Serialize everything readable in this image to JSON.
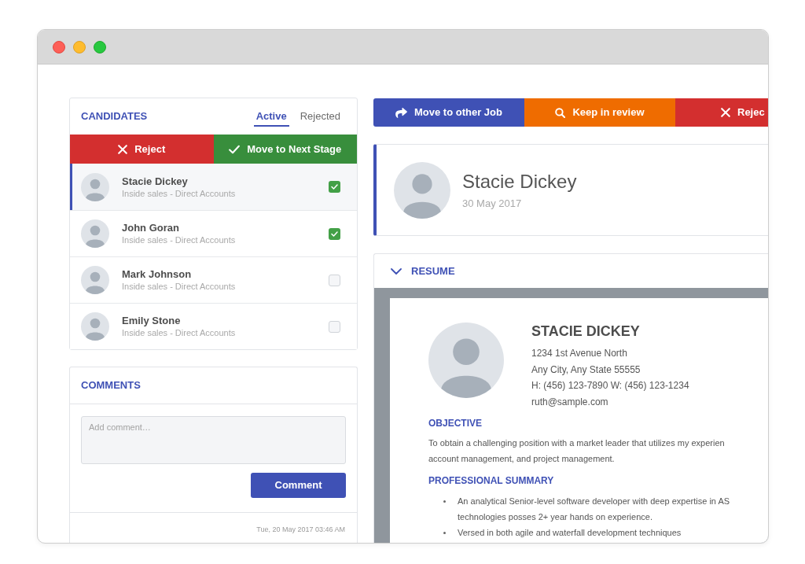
{
  "candidates_panel": {
    "title": "CANDIDATES",
    "tabs": [
      {
        "label": "Active",
        "selected": true
      },
      {
        "label": "Rejected",
        "selected": false
      }
    ],
    "actions": [
      {
        "kind": "reject",
        "label": "Reject"
      },
      {
        "kind": "advance",
        "label": "Move to Next Stage"
      }
    ],
    "candidates": [
      {
        "name": "Stacie Dickey",
        "position": "Inside sales - Direct Accounts",
        "selected": true,
        "checked": true
      },
      {
        "name": "John Goran",
        "position": "Inside sales - Direct Accounts",
        "selected": false,
        "checked": true
      },
      {
        "name": "Mark Johnson",
        "position": "Inside sales - Direct Accounts",
        "selected": false,
        "checked": false
      },
      {
        "name": "Emily Stone",
        "position": "Inside sales - Direct Accounts",
        "selected": false,
        "checked": false
      }
    ]
  },
  "comments_panel": {
    "title": "COMMENTS",
    "comment_field": {
      "placeholder": "Add comment…"
    },
    "button": "Comment",
    "comments": [
      {
        "timestamp": "Tue, 20 May 2017 03:46 AM"
      }
    ]
  },
  "action_bar": [
    {
      "kind": "move",
      "label": "Move to other Job"
    },
    {
      "kind": "review",
      "label": "Keep in review"
    },
    {
      "kind": "reject",
      "label": "Rejec"
    }
  ],
  "candidate_header": {
    "name": "Stacie Dickey",
    "date": "30 May 2017"
  },
  "resume": {
    "title": "RESUME",
    "expanded": true,
    "name": "STACIE DICKEY",
    "contact": [
      "1234 1st Avenue North",
      "Any City, Any State 55555",
      "H: (456) 123-7890 W: (456) 123-1234",
      "ruth@sample.com"
    ],
    "sections": [
      {
        "kind": "paragraph",
        "heading": "OBJECTIVE",
        "lines": [
          "To obtain a challenging position with a market leader that utilizes my experien",
          "account management, and project management."
        ]
      },
      {
        "kind": "bullets",
        "heading": "PROFESSIONAL SUMMARY",
        "items": [
          {
            "lines": [
              "An analytical Senior-level software developer with deep expertise in AS",
              "technologies posses 2+ year hands on experience."
            ]
          },
          {
            "lines": [
              "Versed in both agile and waterfall development techniques"
            ]
          }
        ]
      }
    ]
  }
}
